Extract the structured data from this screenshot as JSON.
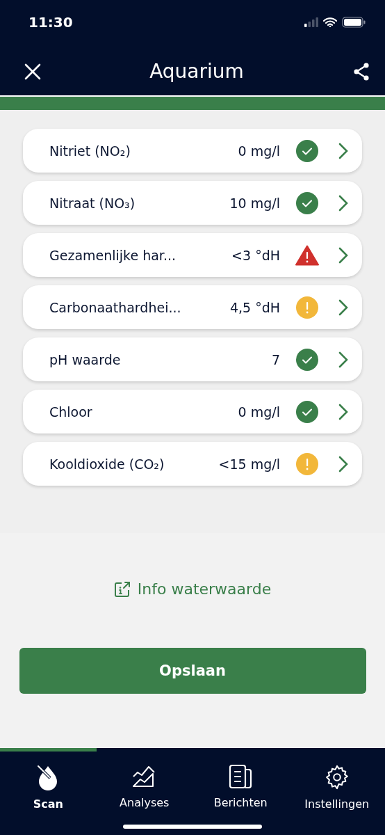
{
  "status_bar": {
    "time": "11:30"
  },
  "header": {
    "title": "Aquarium"
  },
  "measurements": [
    {
      "name": "Nitriet (NO₂)",
      "value": "0 mg/l",
      "kind": "ok"
    },
    {
      "name": "Nitraat (NO₃)",
      "value": "10 mg/l",
      "kind": "ok"
    },
    {
      "name": "Gezamenlijke har...",
      "value": "<3 °dH",
      "kind": "alert"
    },
    {
      "name": "Carbonaathardhei...",
      "value": "4,5 °dH",
      "kind": "warning"
    },
    {
      "name": "pH waarde",
      "value": "7",
      "kind": "ok"
    },
    {
      "name": "Chloor",
      "value": "0 mg/l",
      "kind": "ok"
    },
    {
      "name": "Kooldioxide (CO₂)",
      "value": "<15 mg/l",
      "kind": "warning"
    }
  ],
  "info_link": "Info waterwaarde",
  "save_button": "Opslaan",
  "tabs": [
    {
      "label": "Scan",
      "selected": true
    },
    {
      "label": "Analyses",
      "selected": false
    },
    {
      "label": "Berichten",
      "selected": false
    },
    {
      "label": "Instellingen",
      "selected": false
    }
  ]
}
